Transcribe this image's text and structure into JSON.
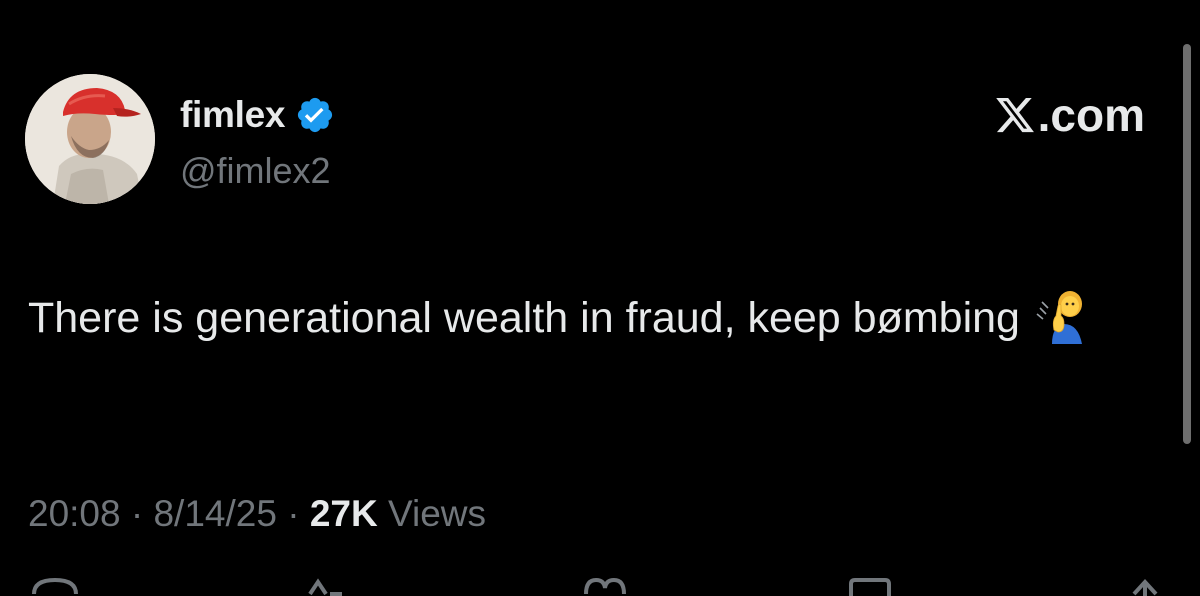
{
  "author": {
    "display_name": "fimlex",
    "handle": "@fimlex2",
    "verified": true
  },
  "source_label": ".com",
  "source_logo": "x-logo-icon",
  "tweet": {
    "text": "There is generational wealth in fraud, keep bømbing",
    "emoji": "person-shushing-emoji"
  },
  "meta": {
    "time": "20:08",
    "sep1": " · ",
    "date": "8/14/25",
    "sep2": " · ",
    "views_count": "27K",
    "views_label": " Views"
  },
  "actions": [
    "reply-icon",
    "repost-icon",
    "like-icon",
    "bookmark-icon",
    "share-icon"
  ],
  "colors": {
    "background": "#000000",
    "primary_text": "#e7e9ea",
    "secondary_text": "#71767b",
    "verified_badge": "#1d9bf0"
  }
}
